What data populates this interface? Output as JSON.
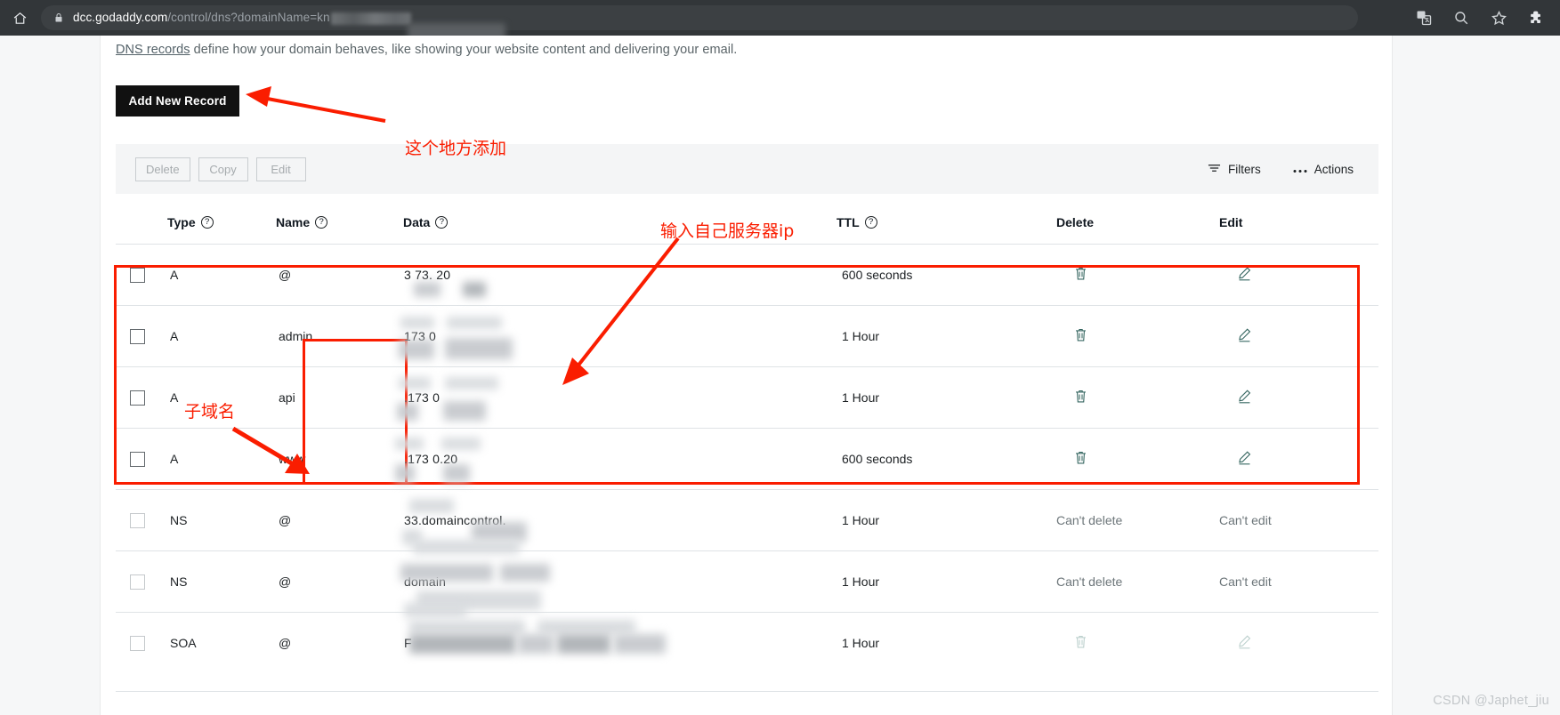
{
  "browser": {
    "home_icon": "home-icon",
    "lock_icon": "lock-icon",
    "url_prefix": "dcc.godaddy.com",
    "url_host_highlight": "godaddy.com",
    "url_path": "/control/dns?domainName=kn",
    "toolbar_icons": [
      "translate-icon",
      "search-icon",
      "bookmark-star-icon",
      "extensions-puzzle-icon"
    ]
  },
  "page": {
    "intro_link": "DNS records",
    "intro_text": " define how your domain behaves, like showing your website content and delivering your email.",
    "add_record_label": "Add New Record"
  },
  "toolbar": {
    "delete_label": "Delete",
    "copy_label": "Copy",
    "edit_label": "Edit",
    "filters_label": "Filters",
    "actions_label": "Actions",
    "filters_icon": "filter-icon",
    "actions_icon": "ellipsis-icon"
  },
  "table": {
    "headers": {
      "type": "Type",
      "name": "Name",
      "data": "Data",
      "ttl": "TTL",
      "delete": "Delete",
      "edit": "Edit",
      "help_glyph": "?"
    },
    "rows": [
      {
        "type": "A",
        "name": "@",
        "data": "3        73.        20",
        "ttl": "600 seconds",
        "delete": "trash-icon",
        "edit": "pencil-icon",
        "delete_text": "",
        "edit_text": "",
        "enabled": true
      },
      {
        "type": "A",
        "name": "admin",
        "data": "      173        0",
        "ttl": "1 Hour",
        "delete": "trash-icon",
        "edit": "pencil-icon",
        "delete_text": "",
        "edit_text": "",
        "enabled": true
      },
      {
        "type": "A",
        "name": "api",
        "data": "  .173        0",
        "ttl": "1 Hour",
        "delete": "trash-icon",
        "edit": "pencil-icon",
        "delete_text": "",
        "edit_text": "",
        "enabled": true
      },
      {
        "type": "A",
        "name": "www",
        "data": "  .173     0.20",
        "ttl": "600 seconds",
        "delete": "trash-icon",
        "edit": "pencil-icon",
        "delete_text": "",
        "edit_text": "",
        "enabled": true
      },
      {
        "type": "NS",
        "name": "@",
        "data": " 33.domaincontrol.",
        "ttl": "1 Hour",
        "delete": "",
        "edit": "",
        "delete_text": "Can't delete",
        "edit_text": "Can't edit",
        "enabled": false
      },
      {
        "type": "NS",
        "name": "@",
        "data": "   domain",
        "ttl": "1 Hour",
        "delete": "",
        "edit": "",
        "delete_text": "Can't delete",
        "edit_text": "Can't edit",
        "enabled": false
      },
      {
        "type": "SOA",
        "name": "@",
        "data": "F",
        "ttl": "1 Hour",
        "delete": "trash-icon-disabled",
        "edit": "pencil-icon-disabled",
        "delete_text": "",
        "edit_text": "",
        "enabled": false
      }
    ]
  },
  "annotations": {
    "add_record_note": "这个地方添加",
    "server_ip_note": "输入自己服务器ip",
    "subdomain_note": "子域名",
    "color": "#fa1d00"
  },
  "watermark": "CSDN @Japhet_jiu"
}
